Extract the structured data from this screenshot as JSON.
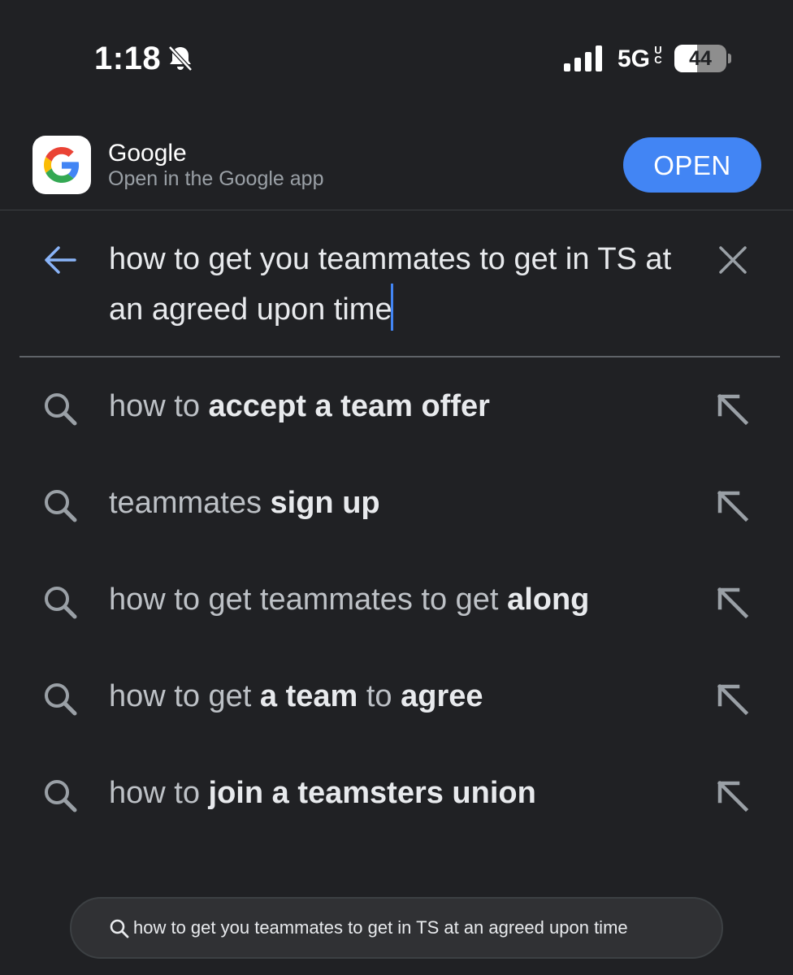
{
  "status_bar": {
    "time": "1:18",
    "network": "5G",
    "network_sub": "UC",
    "battery_level": "44",
    "battery_fraction": 0.44,
    "icons": [
      "bell-slash-icon",
      "signal-icon"
    ]
  },
  "app_banner": {
    "app_name": "Google",
    "subtitle": "Open in the Google app",
    "open_label": "OPEN",
    "icon": "google-g-logo"
  },
  "search": {
    "query": "how to get you teammates to get in TS at an agreed upon time",
    "back_icon": "back-arrow-icon",
    "clear_icon": "close-icon"
  },
  "suggestions": [
    {
      "parts": [
        {
          "text": "how to ",
          "bold": false
        },
        {
          "text": "accept a team offer",
          "bold": true
        }
      ]
    },
    {
      "parts": [
        {
          "text": "teammates ",
          "bold": false
        },
        {
          "text": "sign up",
          "bold": true
        }
      ]
    },
    {
      "parts": [
        {
          "text": "how to get teammates to get ",
          "bold": false
        },
        {
          "text": "along",
          "bold": true
        }
      ]
    },
    {
      "parts": [
        {
          "text": "how to get ",
          "bold": false
        },
        {
          "text": "a team",
          "bold": true
        },
        {
          "text": " to ",
          "bold": false
        },
        {
          "text": "agree",
          "bold": true
        }
      ]
    },
    {
      "parts": [
        {
          "text": "how to ",
          "bold": false
        },
        {
          "text": "join a teamsters union",
          "bold": true
        }
      ]
    }
  ],
  "url_bar": {
    "text": "how to get you teammates to get in TS at an agreed upon time"
  },
  "colors": {
    "background": "#202124",
    "accent": "#4285f4",
    "text_primary": "#e8eaed",
    "text_secondary": "#9aa0a6"
  }
}
